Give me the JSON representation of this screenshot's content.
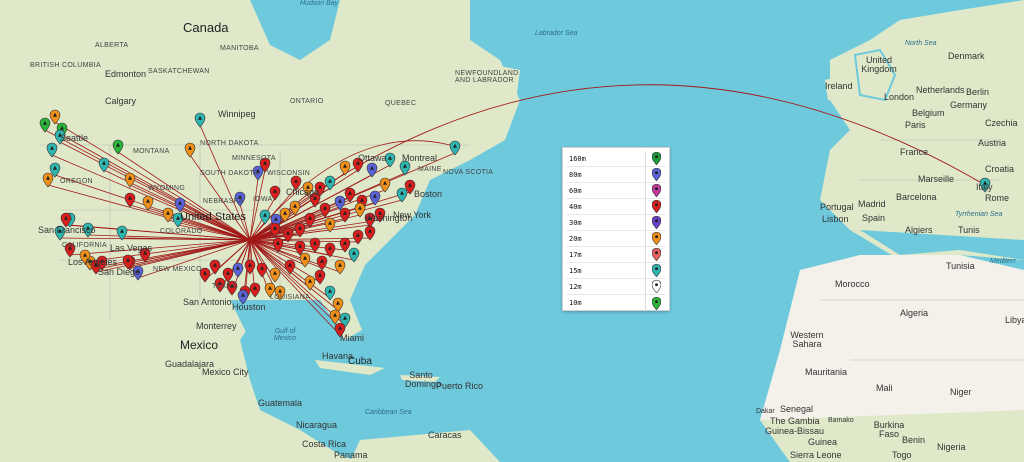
{
  "labels": {
    "hudson_bay": "Hudson Bay",
    "canada": "Canada",
    "alberta": "ALBERTA",
    "manitoba": "MANITOBA",
    "british_columbia": "BRITISH COLUMBIA",
    "saskatchewan": "SASKATCHEWAN",
    "edmonton": "Edmonton",
    "calgary": "Calgary",
    "winnipeg": "Winnipeg",
    "ontario": "ONTARIO",
    "quebec": "QUEBEC",
    "newfoundland": "NEWFOUNDLAND AND LABRADOR",
    "labrador_sea": "Labrador Sea",
    "montana": "MONTANA",
    "north_dakota": "NORTH DAKOTA",
    "south_dakota": "SOUTH DAKOTA",
    "nebraska": "NEBRASKA",
    "oregon": "OREGON",
    "wyoming": "WYOMING",
    "colorado": "COLORADO",
    "california": "CALIFORNIA",
    "new_mexico": "NEW MEXICO",
    "texas": "TEXAS",
    "louisiana": "LOUISIANA",
    "minnesota": "MINNESOTA",
    "wisconsin": "WISCONSIN",
    "iowa": "IOWA",
    "maine": "MAINE",
    "nova_scotia": "NOVA SCOTIA",
    "united_states": "United States",
    "seattle": "Seattle",
    "san_francisco": "San Francisco",
    "los_angeles": "Los Angeles",
    "las_vegas": "Las Vegas",
    "san_diego": "San Diego",
    "chicago": "Chicago",
    "ottawa": "Ottawa",
    "montreal": "Montreal",
    "boston": "Boston",
    "new_york": "New York",
    "washington": "Washington",
    "san_antonio": "San Antonio",
    "houston": "Houston",
    "monterrey": "Monterrey",
    "mexico": "Mexico",
    "gulf_of_mexico": "Gulf of Mexico",
    "miami": "Miami",
    "havana": "Havana",
    "cuba": "Cuba",
    "guadalajara": "Guadalajara",
    "mexico_city": "Mexico City",
    "santo_domingo": "Santo Domingo",
    "puerto_rico": "Puerto Rico",
    "guatemala": "Guatemala",
    "caribbean_sea": "Caribbean Sea",
    "nicaragua": "Nicaragua",
    "costa_rica": "Costa Rica",
    "panama": "Panama",
    "caracas": "Caracas",
    "north_sea": "North Sea",
    "denmark": "Denmark",
    "united_kingdom": "United Kingdom",
    "ireland": "Ireland",
    "london": "London",
    "netherlands": "Netherlands",
    "berlin": "Berlin",
    "germany": "Germany",
    "belgium": "Belgium",
    "paris": "Paris",
    "czechia": "Czechia",
    "france": "France",
    "austria": "Austria",
    "croatia": "Croatia",
    "marseille": "Marseille",
    "italy": "Italy",
    "rome": "Rome",
    "portugal": "Portugal",
    "madrid": "Madrid",
    "barcelona": "Barcelona",
    "spain": "Spain",
    "lisbon": "Lisbon",
    "tyrrhenian_sea": "Tyrrhenian Sea",
    "algiers": "Algiers",
    "tunis": "Tunis",
    "tunisia": "Tunisia",
    "mediterranean": "Mediterr",
    "morocco": "Morocco",
    "algeria": "Algeria",
    "libya": "Libya",
    "western_sahara": "Western Sahara",
    "mauritania": "Mauritania",
    "mali": "Mali",
    "niger": "Niger",
    "dakar": "Dakar",
    "senegal": "Senegal",
    "gambia": "The Gambia",
    "guinea_bissau": "Guinea-Bissau",
    "bamako": "Bamako",
    "guinea": "Guinea",
    "burkina_faso": "Burkina Faso",
    "benin": "Benin",
    "nigeria": "Nigeria",
    "togo": "Togo",
    "sierra_leone": "Sierra Leone"
  },
  "legend": [
    {
      "band": "160m",
      "color": "#1a9b3a"
    },
    {
      "band": "80m",
      "color": "#5a62d8"
    },
    {
      "band": "60m",
      "color": "#c2399a"
    },
    {
      "band": "40m",
      "color": "#d91e1e"
    },
    {
      "band": "30m",
      "color": "#6a3fc9"
    },
    {
      "band": "20m",
      "color": "#f0901a"
    },
    {
      "band": "17m",
      "color": "#e86060"
    },
    {
      "band": "15m",
      "color": "#2fb6b0"
    },
    {
      "band": "12m",
      "color": "#ffffff"
    },
    {
      "band": "10m",
      "color": "#2bb43a"
    }
  ],
  "colors": {
    "ocean": "#6fc9dd",
    "land": "#e8efd8",
    "desert": "#f4f1ea",
    "path": "#a01818"
  }
}
